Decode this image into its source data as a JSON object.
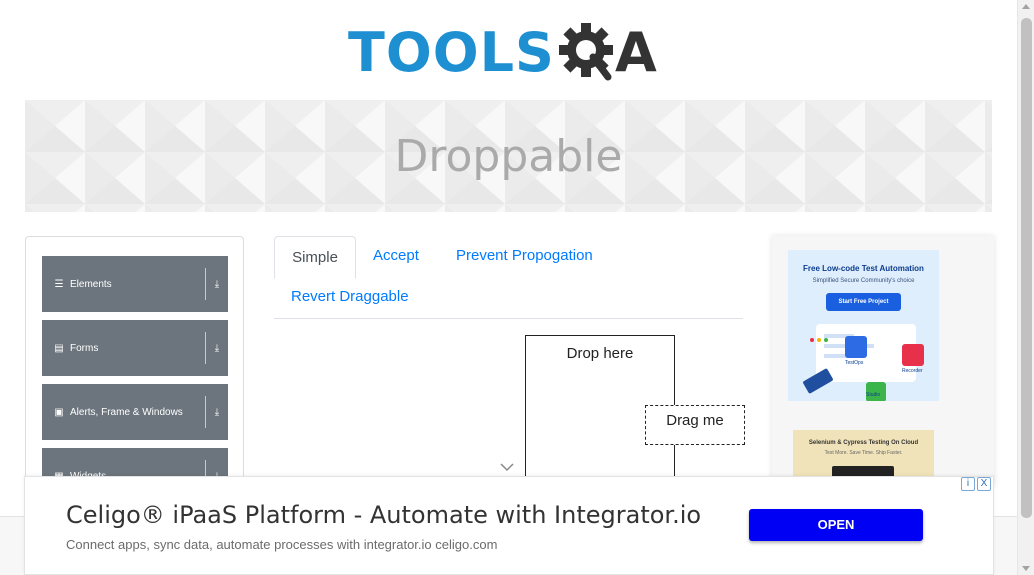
{
  "brand": {
    "logo_part1": "TOOLS",
    "logo_part2": "QA"
  },
  "banner": {
    "title": "Droppable"
  },
  "sidebar": {
    "groups": [
      {
        "label": "Elements",
        "icon": "hamburger-icon"
      },
      {
        "label": "Forms",
        "icon": "document-icon"
      },
      {
        "label": "Alerts, Frame & Windows",
        "icon": "window-icon"
      },
      {
        "label": "Widgets",
        "icon": "grid-icon"
      }
    ]
  },
  "tabs": [
    {
      "label": "Simple",
      "active": true
    },
    {
      "label": "Accept",
      "active": false
    },
    {
      "label": "Prevent Propogation",
      "active": false
    },
    {
      "label": "Revert Draggable",
      "active": false
    }
  ],
  "droppable": {
    "drop_label": "Drop here",
    "drag_label": "Drag me"
  },
  "side_ad": {
    "headline": "Free Low-code Test Automation",
    "subline": "Simplified Secure Community's choice",
    "cta": "Start Free Project",
    "app_labels": [
      "TestOps",
      "Recorder",
      "Studio"
    ],
    "headline2": "Selenium & Cypress Testing On Cloud",
    "subline2": "Test More. Save Time. Ship Faster."
  },
  "bottom_ad": {
    "title": "Celigo® iPaaS Platform - Automate with Integrator.io",
    "description": "Connect apps, sync data, automate processes with integrator.io celigo.com",
    "cta": "OPEN",
    "adchoice_info": "i",
    "adchoice_close": "X"
  },
  "colors": {
    "brand_blue": "#1e8fd1",
    "group_gray": "#6c757d",
    "link_blue": "#007bff",
    "ad_button": "#0000f5"
  }
}
